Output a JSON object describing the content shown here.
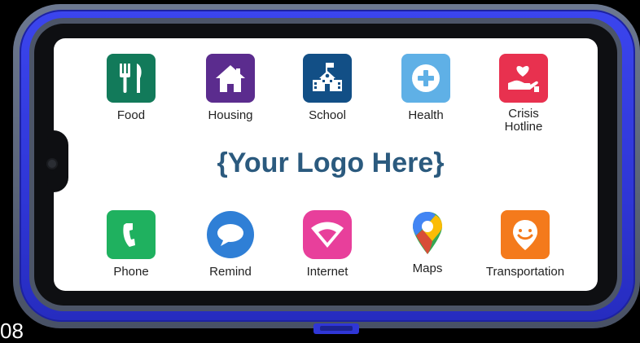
{
  "brand_colors": {
    "case_blue": "#2f36d6",
    "case_gray": "#5a6479",
    "logo_text": "#2b5a7e"
  },
  "logo_placeholder": "{Your Logo Here}",
  "corner_text": "08",
  "apps_top": [
    {
      "label": "Food",
      "icon": "fork-knife-icon",
      "color": "#127a5a"
    },
    {
      "label": "Housing",
      "icon": "house-icon",
      "color": "#5b2c8e"
    },
    {
      "label": "School",
      "icon": "school-building-icon",
      "color": "#124f86"
    },
    {
      "label": "Health",
      "icon": "medical-cross-icon",
      "color": "#5fb0e6"
    },
    {
      "label": "Crisis\nHotline",
      "icon": "heart-in-hand-icon",
      "color": "#e8314f"
    }
  ],
  "apps_bottom": [
    {
      "label": "Phone",
      "icon": "phone-icon",
      "color": "#1fb15f"
    },
    {
      "label": "Remind",
      "icon": "speech-bubble-icon",
      "color": "#2f7fd6"
    },
    {
      "label": "Internet",
      "icon": "wifi-icon",
      "color": "#e83f9b"
    },
    {
      "label": "Maps",
      "icon": "map-pin-icon",
      "color": "#ffffff"
    },
    {
      "label": "Transportation",
      "icon": "smiley-pin-icon",
      "color": "#f47a1c"
    }
  ]
}
